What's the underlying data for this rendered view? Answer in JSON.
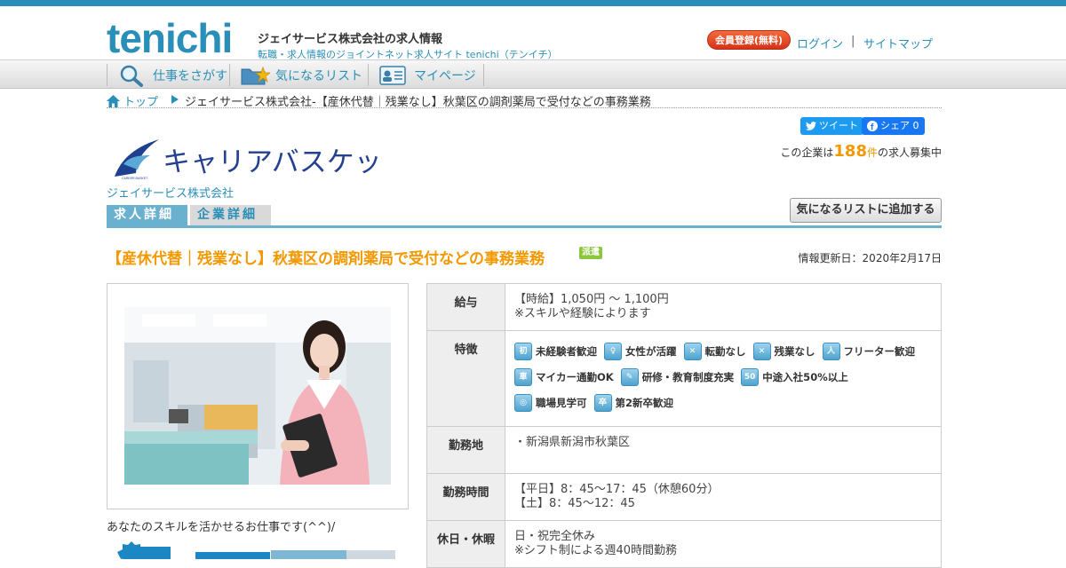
{
  "header": {
    "logo": "tenichi",
    "title": "ジェイサービス株式会社の求人情報",
    "subtitle": "転職・求人情報のジョイントネット求人サイト tenichi（テンイチ）",
    "register_label": "会員登録(無料)",
    "login_label": "ログイン",
    "separator": "|",
    "sitemap_label": "サイトマップ"
  },
  "nav": {
    "items": [
      {
        "label": "仕事をさがす",
        "icon": "magnifier-icon"
      },
      {
        "label": "気になるリスト",
        "icon": "folder-star-icon"
      },
      {
        "label": "マイページ",
        "icon": "id-card-icon"
      }
    ]
  },
  "breadcrumb": {
    "home": "トップ",
    "current": "ジェイサービス株式会社-【産休代替｜残業なし】秋葉区の調剤薬局で受付などの事務業務"
  },
  "social": {
    "tweet": "ツイート",
    "share": "シェア 0"
  },
  "company": {
    "brand": "キャリアバスケット",
    "brand_small": "CAREER BASKET",
    "name": "ジェイサービス株式会社",
    "count_prefix": "この企業は",
    "count": "188",
    "count_unit": "件",
    "count_suffix": "の求人募集中"
  },
  "tabs": [
    "求人詳細",
    "企業詳細"
  ],
  "add_list_label": "気になるリストに追加する",
  "job": {
    "title": "【産休代替｜残業なし】秋葉区の調剤薬局で受付などの事務業務",
    "badge": "派遣",
    "updated": "情報更新日：2020年2月17日",
    "caption": "あなたのスキルを活かせるお仕事です(^^)/"
  },
  "info": {
    "salary_label": "給与",
    "salary_line1": "【時給】1,050円 ～ 1,100円",
    "salary_line2": "※スキルや経験によります",
    "features_label": "特徴",
    "features": [
      {
        "label": "未経験者歓迎",
        "icon": "beginner-icon"
      },
      {
        "label": "女性が活躍",
        "icon": "woman-icon"
      },
      {
        "label": "転勤なし",
        "icon": "no-transfer-icon"
      },
      {
        "label": "残業なし",
        "icon": "no-overtime-icon"
      },
      {
        "label": "フリーター歓迎",
        "icon": "freeter-icon"
      },
      {
        "label": "マイカー通勤OK",
        "icon": "car-icon"
      },
      {
        "label": "研修・教育制度充実",
        "icon": "training-icon"
      },
      {
        "label": "中途入社50%以上",
        "icon": "fifty-percent-icon"
      },
      {
        "label": "職場見学可",
        "icon": "visit-icon"
      },
      {
        "label": "第2新卒歓迎",
        "icon": "graduate-icon"
      }
    ],
    "place_label": "勤務地",
    "place": "・新潟県新潟市秋葉区",
    "time_label": "勤務時間",
    "time_line1": "【平日】8：45～17：45（休憩60分）",
    "time_line2": "【土】8：45～12：45",
    "holiday_label": "休日・休暇",
    "holiday_line1": "日・祝完全休み",
    "holiday_line2": "※シフト制による週40時間勤務"
  },
  "colors": {
    "accent": "#2a8fb8",
    "orange": "#f39800",
    "badge": "#8cc63f"
  }
}
